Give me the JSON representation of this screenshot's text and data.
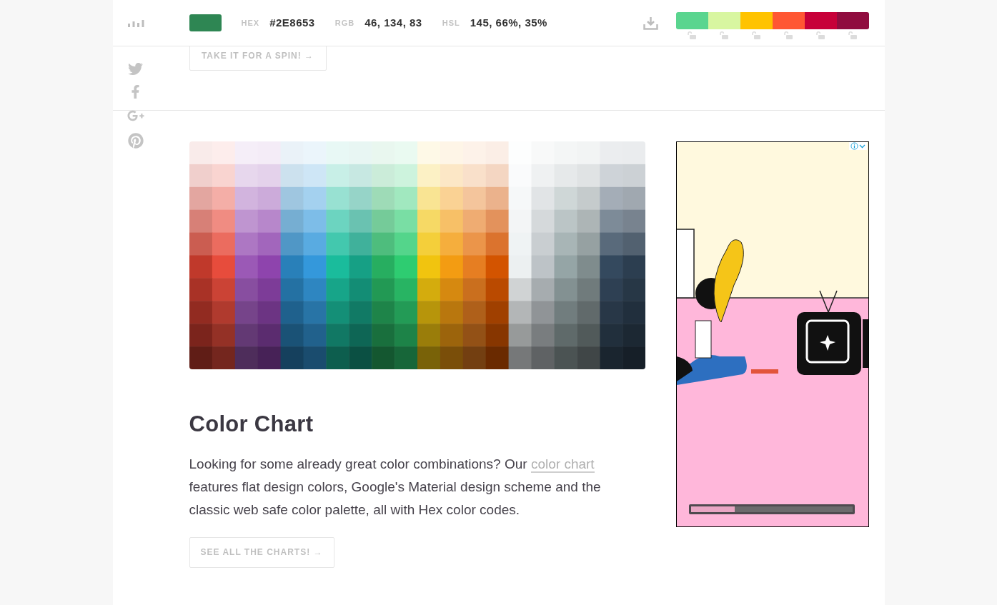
{
  "header": {
    "current_color": {
      "color": "#2e8653"
    },
    "values": [
      {
        "label": "HEX",
        "value": "#2E8653"
      },
      {
        "label": "RGB",
        "value": "46, 134, 83"
      },
      {
        "label": "HSL",
        "value": "145, 66%, 35%"
      }
    ],
    "palette": [
      {
        "color": "#5ad58f",
        "locked": false
      },
      {
        "color": "#d8f6a1",
        "locked": false
      },
      {
        "color": "#ffc300",
        "locked": false
      },
      {
        "color": "#ff5733",
        "locked": false
      },
      {
        "color": "#c70039",
        "locked": false
      },
      {
        "color": "#900c3f",
        "locked": false
      }
    ]
  },
  "spin_button": "TAKE IT FOR A SPIN! →",
  "section": {
    "title": "Color Chart",
    "text_before": "Looking for some already great color combinations? Our",
    "link": "color chart",
    "text_after": "features flat design colors, Google's Material design scheme and the classic web safe color palette, all with Hex color codes.",
    "button": "SEE ALL THE CHARTS! →"
  },
  "ad": {
    "progress": {
      "level": 0.27
    }
  }
}
